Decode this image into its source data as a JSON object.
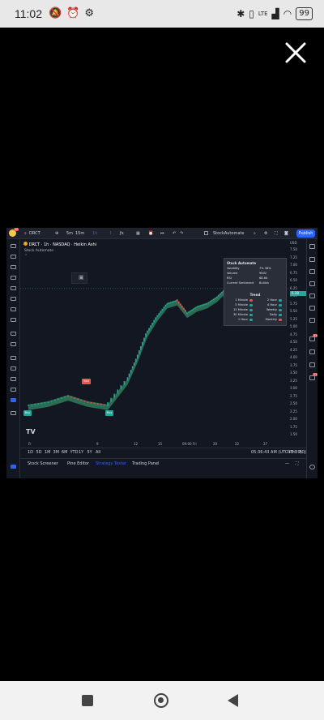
{
  "status_bar": {
    "time": "11:02",
    "battery": "99",
    "network": "LTE"
  },
  "viewer": {
    "close_icon": "close-icon"
  },
  "tv": {
    "symbol_search": "DRCT",
    "intervals": [
      "5m",
      "15m",
      "1h"
    ],
    "indicator_label": "StockAutomate",
    "publish_label": "Publish",
    "legend_symbol": "DRCT · 1h · NASDAQ · Heikin Ashi",
    "legend_indicator": "Stock Automate",
    "currency": "USD",
    "price_ticks": [
      "7.50",
      "7.25",
      "7.00",
      "6.75",
      "6.50",
      "6.25",
      "6.00",
      "5.75",
      "5.50",
      "5.25",
      "5.00",
      "4.75",
      "4.50",
      "4.25",
      "4.00",
      "3.75",
      "3.50",
      "3.25",
      "3.00",
      "2.75",
      "2.50",
      "2.25",
      "2.00",
      "1.75",
      "1.50"
    ],
    "last_price": "6.28",
    "time_ticks": [
      "9",
      "12",
      "15",
      "09:00 Fri",
      "20",
      "22",
      "27"
    ],
    "time_axis_start": "Fr",
    "ranges": [
      "1D",
      "5D",
      "1M",
      "3M",
      "6M",
      "YTD",
      "1Y",
      "5Y",
      "All"
    ],
    "clock": "05:36:43 AM (UTC+5:30)",
    "session": "RTH",
    "adj": "ADJ",
    "bottom_tabs": [
      "Stock Screener",
      "Pine Editor",
      "Strategy Tester",
      "Trading Panel"
    ],
    "signals": {
      "buy": "Buy",
      "sell": "Sell"
    },
    "watermark": "TV",
    "badge_count": "10",
    "right_badge_1": "33",
    "right_badge_2": "11"
  },
  "indicator_table": {
    "title": "Stock Automate",
    "rows": [
      {
        "k": "Volatility",
        "v": "7% 36%"
      },
      {
        "k": "Volume",
        "v": "9842"
      },
      {
        "k": "RSI",
        "v": "68.64"
      },
      {
        "k": "Current Sentiment",
        "v": "Bullish"
      }
    ],
    "trend_title": "Trend",
    "trend_rows": [
      {
        "l": "1 Minute",
        "r": "2 Hour",
        "lc": "#ef5350",
        "rc": "#26a69a"
      },
      {
        "l": "5 Minute",
        "r": "4 Hour",
        "lc": "#26a69a",
        "rc": "#26a69a"
      },
      {
        "l": "15 Minute",
        "r": "Weekly",
        "lc": "#26a69a",
        "rc": "#26a69a"
      },
      {
        "l": "30 Minute",
        "r": "Daily",
        "lc": "#26a69a",
        "rc": "#26a69a"
      },
      {
        "l": "1 Hour",
        "r": "Monthly",
        "lc": "#26a69a",
        "rc": "#ef5350"
      }
    ]
  },
  "chart_data": {
    "type": "line",
    "series": [
      {
        "x": [
          0,
          10,
          20,
          30,
          40,
          50,
          55,
          60,
          65,
          70,
          75,
          80,
          85,
          90,
          95,
          100
        ],
        "values": [
          2.5,
          2.6,
          2.8,
          2.6,
          2.5,
          3.3,
          4.0,
          4.8,
          5.3,
          5.7,
          5.8,
          5.4,
          5.6,
          5.7,
          5.9,
          6.2
        ]
      }
    ],
    "ylim": [
      1.5,
      7.5
    ],
    "colors": {
      "bull": "#26a69a",
      "bear": "#ef5350",
      "band": "#2e7d5b"
    }
  }
}
